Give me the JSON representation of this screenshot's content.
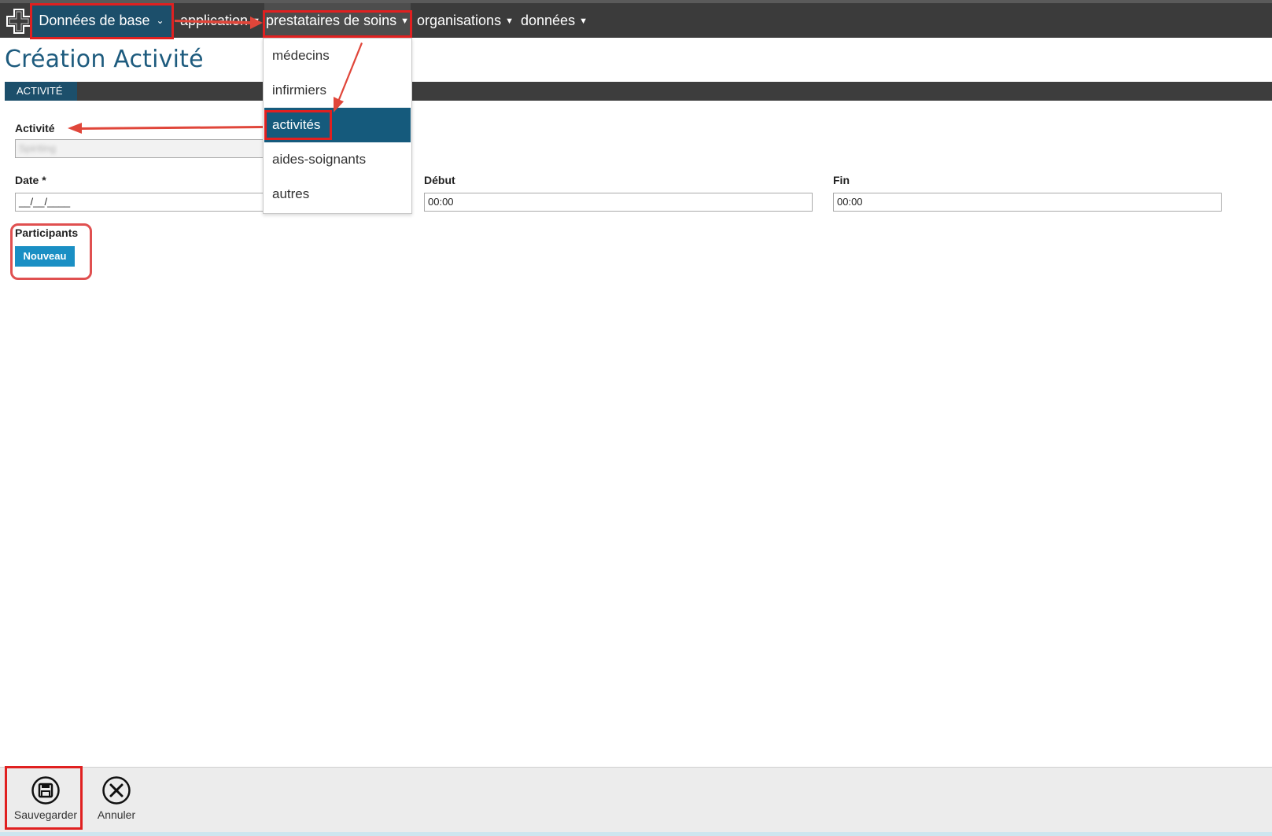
{
  "nav": {
    "base": "Données de base",
    "application": "application",
    "prestataires": "prestataires de soins",
    "organisations": "organisations",
    "donnees": "données"
  },
  "page": {
    "title": "Création Activité",
    "section": "ACTIVITÉ"
  },
  "form": {
    "activite_label": "Activité",
    "activite_value": "Spiriting",
    "date_label": "Date *",
    "date_value": "__/__/____",
    "debut_label": "Début",
    "debut_value": "00:00",
    "fin_label": "Fin",
    "fin_value": "00:00",
    "participants_label": "Participants",
    "nouveau_label": "Nouveau"
  },
  "dropdown": {
    "items": [
      "médecins",
      "infirmiers",
      "activités",
      "aides-soignants",
      "autres"
    ],
    "active": "activités"
  },
  "toolbar": {
    "save_label": "Sauvegarder",
    "cancel_label": "Annuler"
  },
  "colors": {
    "nav_bg": "#3b3b3b",
    "accent": "#1c4f6b",
    "button": "#1a8fc4",
    "annotation": "#e02020"
  }
}
